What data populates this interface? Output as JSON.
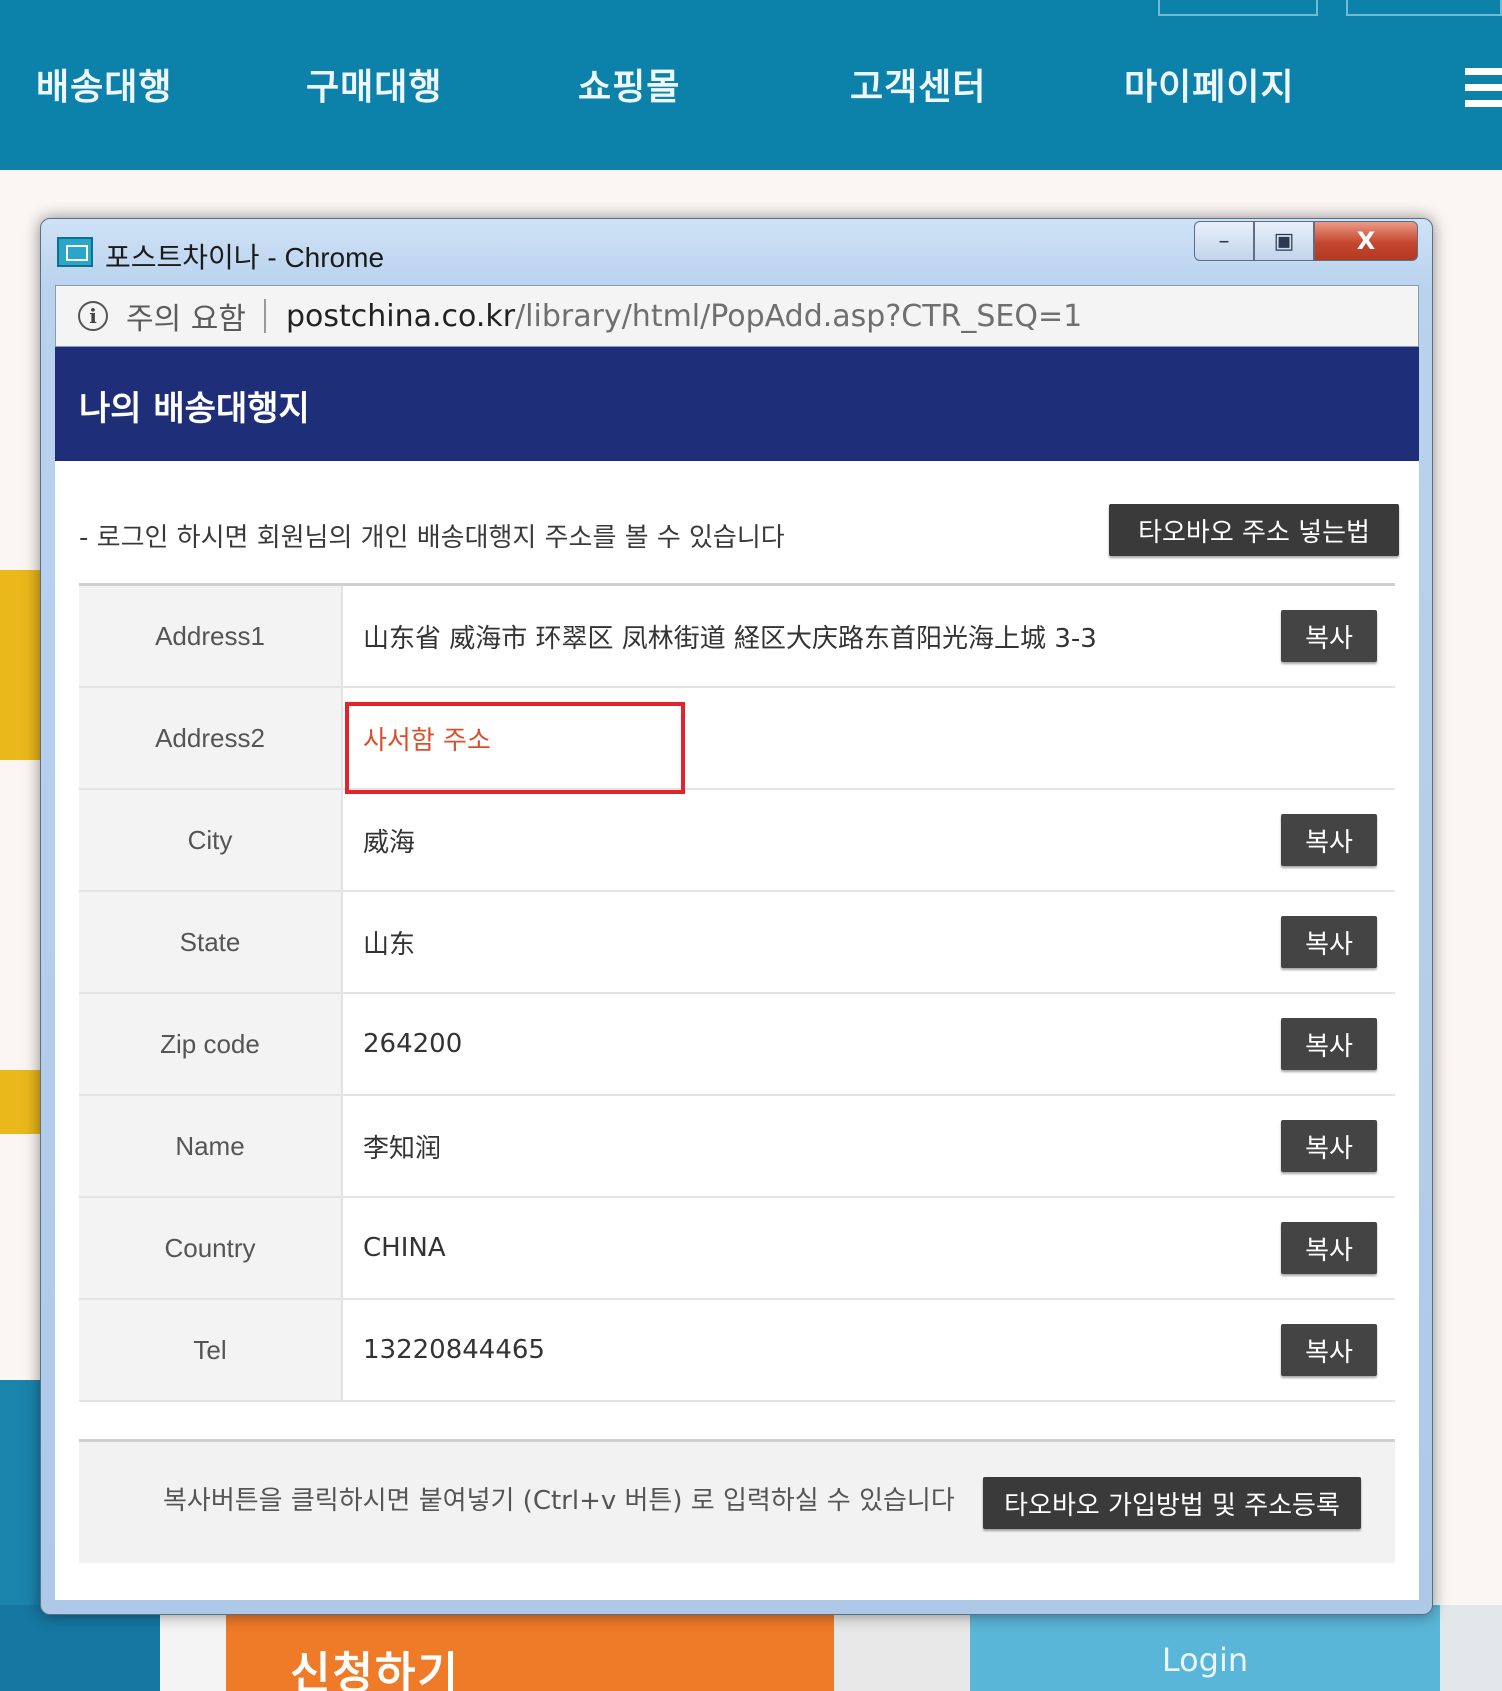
{
  "site": {
    "menu": [
      "배송대행",
      "구매대행",
      "쇼핑몰",
      "고객센터",
      "마이페이지"
    ],
    "apply_label": "신청하기",
    "login_label": "Login"
  },
  "window": {
    "title": "포스트차이나 - Chrome",
    "close_glyph": "X",
    "address_bar": {
      "warning": "주의 요함",
      "host": "postchina.co.kr",
      "path": "/library/html/PopAdd.asp?CTR_SEQ=1"
    }
  },
  "popup": {
    "heading": "나의 배송대행지",
    "intro": "- 로그인 하시면 회원님의 개인 배송대행지 주소를 볼 수 있습니다",
    "taobao_guide_button": "타오바오 주소 넣는법",
    "copy_label": "복사",
    "rows": [
      {
        "label": "Address1",
        "value": "山东省 威海市 环翠区 凤林街道  経区大庆路东首阳光海上城 3-3"
      },
      {
        "label": "Address2",
        "value": "사서함 주소"
      },
      {
        "label": "City",
        "value": "威海"
      },
      {
        "label": "State",
        "value": "山东"
      },
      {
        "label": "Zip code",
        "value": "264200"
      },
      {
        "label": "Name",
        "value": "李知润"
      },
      {
        "label": "Country",
        "value": "CHINA"
      },
      {
        "label": "Tel",
        "value": "13220844465"
      }
    ],
    "footer_note": "복사버튼을 클릭하시면 붙여넣기 (Ctrl+v 버튼) 로 입력하실 수 있습니다",
    "footer_button": "타오바오 가입방법 및 주소등록"
  },
  "colors": {
    "nav": "#0c82aa",
    "header_band": "#1f2e79",
    "highlight": "#e2232b",
    "address2_text": "#d9502e"
  }
}
